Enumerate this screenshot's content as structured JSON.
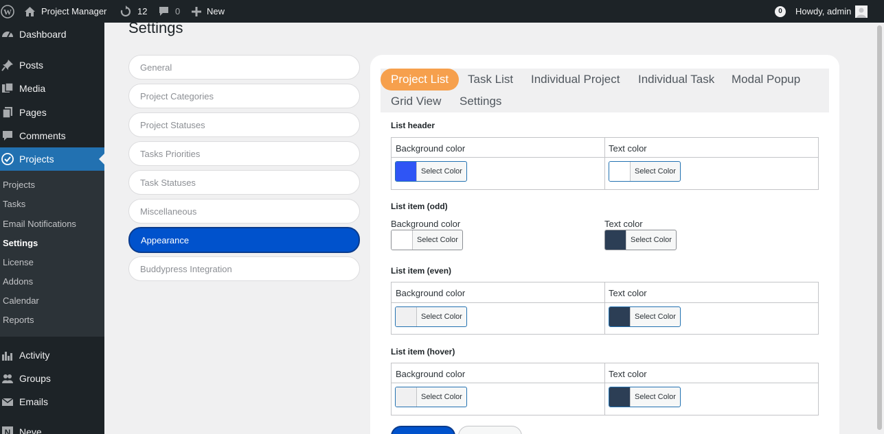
{
  "adminbar": {
    "site_name": "Project Manager",
    "updates_count": "12",
    "comments_count": "0",
    "new_label": "New",
    "notifications_count": "0",
    "greeting": "Howdy, admin"
  },
  "sidebar": {
    "items": [
      {
        "label": "Dashboard",
        "icon": "dashboard-icon"
      },
      {
        "label": "Posts",
        "icon": "pushpin-icon"
      },
      {
        "label": "Media",
        "icon": "media-icon"
      },
      {
        "label": "Pages",
        "icon": "pages-icon"
      },
      {
        "label": "Comments",
        "icon": "comment-icon"
      },
      {
        "label": "Projects",
        "icon": "check-circle-icon"
      },
      {
        "label": "Activity",
        "icon": "activity-icon"
      },
      {
        "label": "Groups",
        "icon": "groups-icon"
      },
      {
        "label": "Emails",
        "icon": "envelope-icon"
      },
      {
        "label": "Neve",
        "icon": "neve-icon"
      }
    ],
    "submenu": [
      "Projects",
      "Tasks",
      "Email Notifications",
      "Settings",
      "License",
      "Addons",
      "Calendar",
      "Reports"
    ]
  },
  "page": {
    "title": "Settings"
  },
  "settings_nav": [
    "General",
    "Project Categories",
    "Project Statuses",
    "Tasks Priorities",
    "Task Statuses",
    "Miscellaneous",
    "Appearance",
    "Buddypress Integration"
  ],
  "tabs": [
    "Project List",
    "Task List",
    "Individual Project",
    "Individual Task",
    "Modal Popup",
    "Grid View",
    "Settings"
  ],
  "sections": {
    "list_header": {
      "title": "List header",
      "bg_label": "Background color",
      "text_label": "Text color",
      "bg_color": "#2f55f5",
      "text_color": "#ffffff"
    },
    "list_odd": {
      "title": "List item (odd)",
      "bg_label": "Background color",
      "text_label": "Text color",
      "bg_color": "#ffffff",
      "text_color": "#2c3e55"
    },
    "list_even": {
      "title": "List item (even)",
      "bg_label": "Background color",
      "text_label": "Text color",
      "bg_color": "#f0f0f1",
      "text_color": "#2c3e55"
    },
    "list_hover": {
      "title": "List item (hover)",
      "bg_label": "Background color",
      "text_label": "Text color",
      "bg_color": "#f0f0f1",
      "text_color": "#2c3e55"
    }
  },
  "select_color_label": "Select Color",
  "colors": {
    "accent": "#2271b1",
    "active_nav": "#0052cc",
    "active_tab": "#f6a04d",
    "adminbar": "#1d2327"
  }
}
